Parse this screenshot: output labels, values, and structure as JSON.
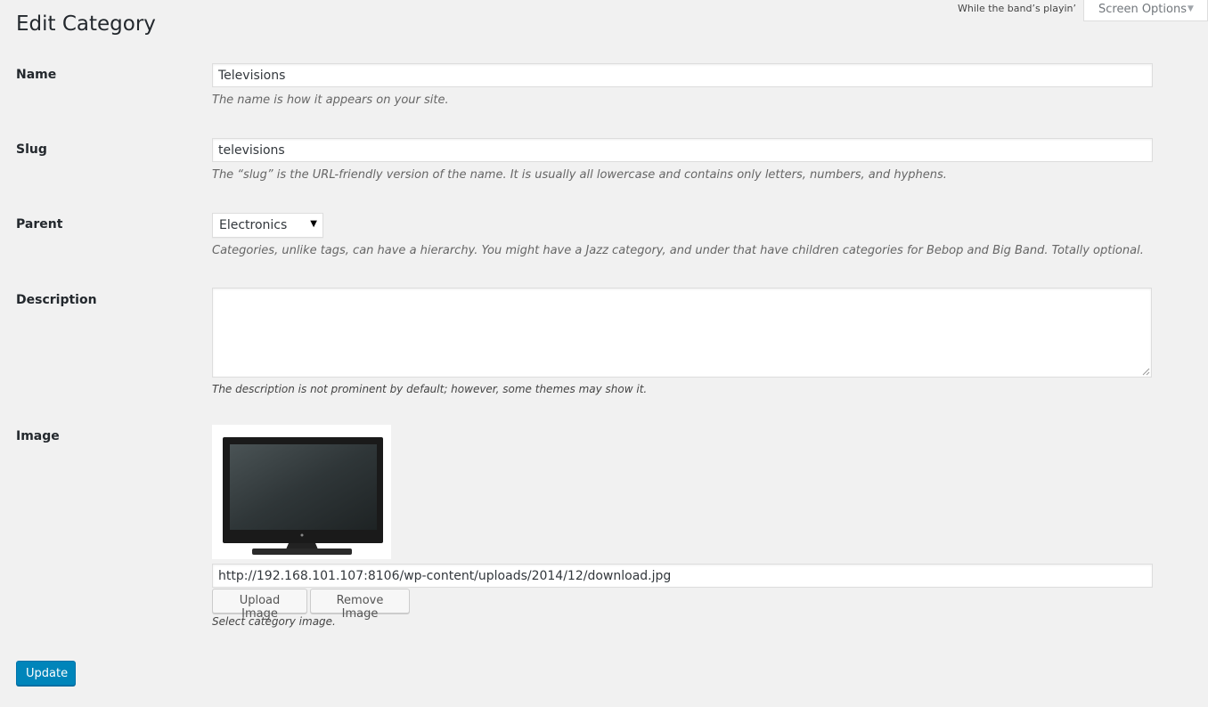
{
  "header": {
    "title": "Edit Category",
    "hello_dolly": "While the band’s playin’",
    "screen_options_label": "Screen Options"
  },
  "form": {
    "name": {
      "label": "Name",
      "value": "Televisions",
      "description": "The name is how it appears on your site."
    },
    "slug": {
      "label": "Slug",
      "value": "televisions",
      "description": "The “slug” is the URL-friendly version of the name. It is usually all lowercase and contains only letters, numbers, and hyphens."
    },
    "parent": {
      "label": "Parent",
      "selected": "Electronics",
      "description": "Categories, unlike tags, can have a hierarchy. You might have a Jazz category, and under that have children categories for Bebop and Big Band. Totally optional."
    },
    "description": {
      "label": "Description",
      "value": "",
      "description": "The description is not prominent by default; however, some themes may show it."
    },
    "image": {
      "label": "Image",
      "url": "http://192.168.101.107:8106/wp-content/uploads/2014/12/download.jpg",
      "upload_label": "Upload Image",
      "remove_label": "Remove Image",
      "description": "Select category image."
    },
    "submit_label": "Update"
  },
  "icons": {
    "screen_options_arrow": "triangle-down-icon",
    "select_caret": "caret-down-icon",
    "resize_grip": "resize-grip-icon"
  },
  "colors": {
    "background": "#f1f1f1",
    "primary_button": "#0085ba"
  }
}
